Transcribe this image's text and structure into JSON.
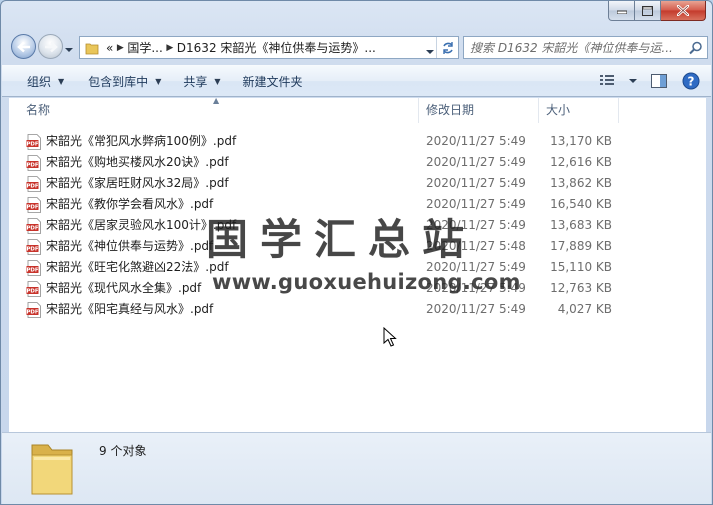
{
  "window": {
    "caption": {
      "minimize": "minimize",
      "maximize": "maximize",
      "close": "close"
    }
  },
  "address": {
    "overflow": "«",
    "crumbs": [
      "国学...",
      "D1632 宋韶光《神位供奉与运势》..."
    ]
  },
  "search": {
    "placeholder": "搜索 D1632 宋韶光《神位供奉与运..."
  },
  "toolbar": {
    "organize": "组织",
    "include_in_library": "包含到库中",
    "share": "共享",
    "new_folder": "新建文件夹"
  },
  "columns": {
    "name": "名称",
    "date": "修改日期",
    "size": "大小"
  },
  "files": [
    {
      "name": "宋韶光《常犯风水弊病100例》.pdf",
      "date": "2020/11/27 5:49",
      "size": "13,170 KB"
    },
    {
      "name": "宋韶光《购地买楼风水20诀》.pdf",
      "date": "2020/11/27 5:49",
      "size": "12,616 KB"
    },
    {
      "name": "宋韶光《家居旺财风水32局》.pdf",
      "date": "2020/11/27 5:49",
      "size": "13,862 KB"
    },
    {
      "name": "宋韶光《教你学会看风水》.pdf",
      "date": "2020/11/27 5:49",
      "size": "16,540 KB"
    },
    {
      "name": "宋韶光《居家灵验风水100计》.pdf",
      "date": "2020/11/27 5:49",
      "size": "13,683 KB"
    },
    {
      "name": "宋韶光《神位供奉与运势》.pdf",
      "date": "2020/11/27 5:48",
      "size": "17,889 KB"
    },
    {
      "name": "宋韶光《旺宅化煞避凶22法》.pdf",
      "date": "2020/11/27 5:49",
      "size": "15,110 KB"
    },
    {
      "name": "宋韶光《现代风水全集》.pdf",
      "date": "2020/11/27 5:49",
      "size": "12,763 KB"
    },
    {
      "name": "宋韶光《阳宅真经与风水》.pdf",
      "date": "2020/11/27 5:49",
      "size": "4,027 KB"
    }
  ],
  "watermark": {
    "title": "国学汇总站",
    "url": "www.guoxuehuizong.com"
  },
  "details": {
    "count": "9 个对象"
  },
  "colors": {
    "accent": "#1e395b",
    "pdf_red": "#c8322a",
    "folder_yellow": "#e9c65a"
  }
}
